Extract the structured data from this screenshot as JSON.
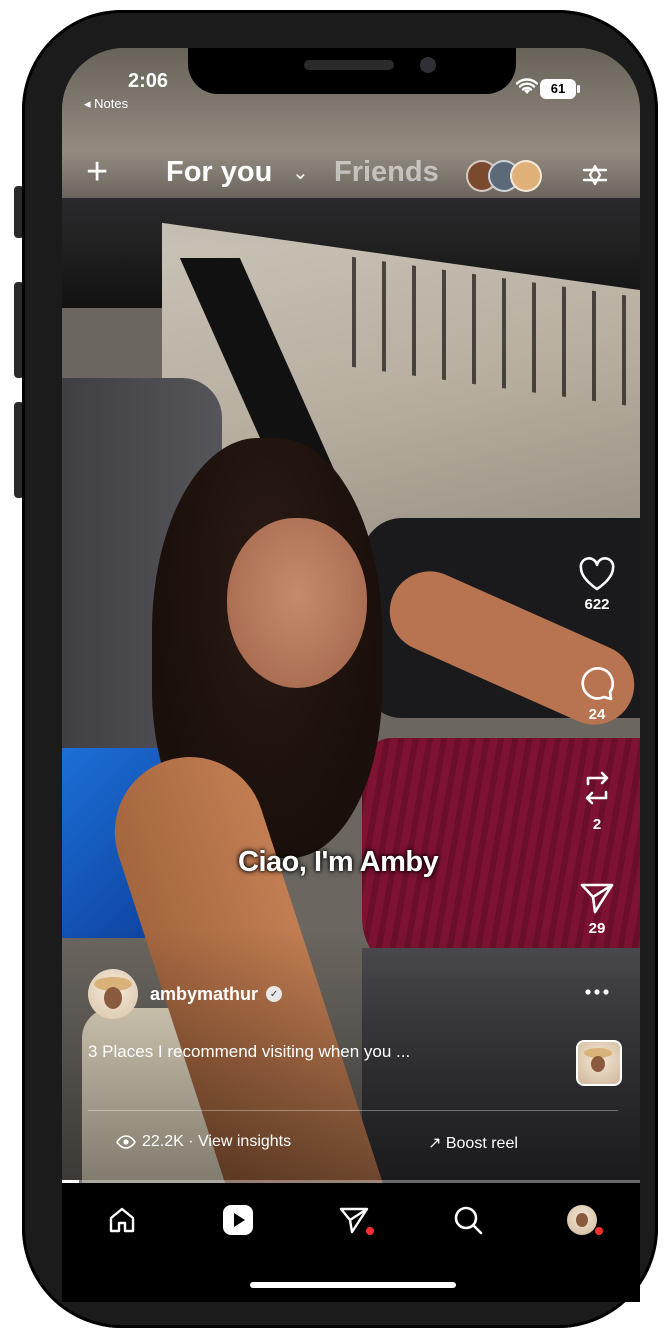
{
  "status_bar": {
    "time": "2:06",
    "back_app": "◂ Notes",
    "battery": "61"
  },
  "top_nav": {
    "tabs": [
      {
        "label": "For you",
        "selected": true
      },
      {
        "label": "Friends",
        "selected": false
      }
    ],
    "chevron": "⌄"
  },
  "actions": [
    {
      "name": "like",
      "icon": "heart-icon",
      "count": "622"
    },
    {
      "name": "comment",
      "icon": "comment-icon",
      "count": "24"
    },
    {
      "name": "repost",
      "icon": "repost-icon",
      "count": "2"
    },
    {
      "name": "share",
      "icon": "send-icon",
      "count": "29"
    },
    {
      "name": "more",
      "icon": "more-icon",
      "count": ""
    }
  ],
  "video": {
    "overlay_text": "Ciao, I'm Amby",
    "progress": 0.03
  },
  "post": {
    "username": "ambymathur",
    "verified_mark": "✓",
    "caption": "3 Places I recommend visiting when you ...",
    "views": "22.2K · View insights",
    "boost_label": "↗ Boost reel"
  },
  "bottom_nav": {
    "items": [
      "home-icon",
      "reels-icon",
      "messages-icon",
      "search-icon",
      "profile-avatar"
    ]
  }
}
